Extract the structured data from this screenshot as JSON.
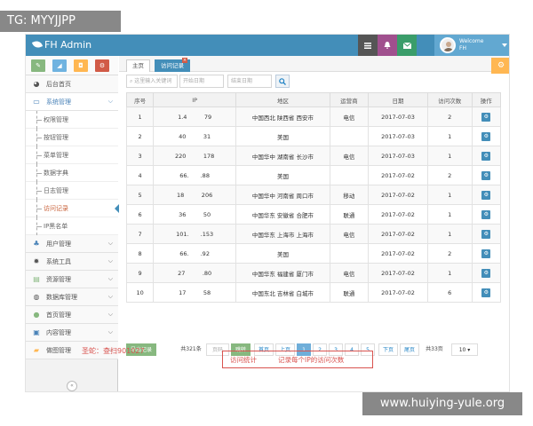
{
  "overlay_label": "TG: MYYJJPP",
  "watermark": "www.huiying-yule.org",
  "footer_note": "圣蛇：查扫901027",
  "app": {
    "title": "FH Admin",
    "welcome": "Welcome",
    "user": "FH",
    "colors": {
      "topbar": "#438eb9",
      "accent": "#438eb9",
      "warning": "#ffb752",
      "danger": "#d15b47",
      "success": "#87b87f"
    }
  },
  "sidebar": {
    "items": [
      {
        "label": "后台首页",
        "icon": "dashboard-icon"
      },
      {
        "label": "系统管理",
        "icon": "desktop-icon"
      },
      {
        "label": "用户管理",
        "icon": "users-icon"
      },
      {
        "label": "系统工具",
        "icon": "cog-icon"
      },
      {
        "label": "资源管理",
        "icon": "list-icon"
      },
      {
        "label": "数据库管理",
        "icon": "database-icon"
      },
      {
        "label": "首页管理",
        "icon": "globe-icon"
      },
      {
        "label": "内容管理",
        "icon": "book-icon"
      },
      {
        "label": "做图管理",
        "icon": "folder-icon"
      }
    ],
    "subitems": [
      "权限管理",
      "按钮管理",
      "菜单管理",
      "数据字典",
      "日志管理",
      "访问记录",
      "IP黑名单"
    ]
  },
  "tabs": [
    {
      "label": "主页"
    },
    {
      "label": "访问记录"
    }
  ],
  "search": {
    "keyword_placeholder": "这里输入关键词",
    "start_placeholder": "开始日期",
    "end_placeholder": "结束日期"
  },
  "table": {
    "headers": [
      "序号",
      "IP",
      "地区",
      "运营商",
      "日期",
      "访问次数",
      "操作"
    ],
    "rows": [
      [
        "1",
        "1.4   79",
        "中国西北 陕西省 西安市",
        "电信",
        "2017-07-03",
        "2"
      ],
      [
        "2",
        "40   31",
        "美国",
        "",
        "2017-07-03",
        "1"
      ],
      [
        "3",
        "220   178",
        "中国华中 湖南省 长沙市",
        "电信",
        "2017-07-03",
        "1"
      ],
      [
        "4",
        "66.  .88",
        "美国",
        "",
        "2017-07-02",
        "2"
      ],
      [
        "5",
        "18   206",
        "中国华中 河南省 周口市",
        "移动",
        "2017-07-02",
        "1"
      ],
      [
        "6",
        "36   50",
        "中国华东 安徽省 合肥市",
        "联通",
        "2017-07-02",
        "1"
      ],
      [
        "7",
        "101.  .153",
        "中国华东 上海市 上海市",
        "电信",
        "2017-07-02",
        "1"
      ],
      [
        "8",
        "66.  .92",
        "美国",
        "",
        "2017-07-02",
        "2"
      ],
      [
        "9",
        "27   .80",
        "中国华东 福建省 厦门市",
        "电信",
        "2017-07-02",
        "1"
      ],
      [
        "10",
        "17   58",
        "中国东北 吉林省 白城市",
        "联通",
        "2017-07-02",
        "6"
      ]
    ]
  },
  "pager": {
    "export_label": "导出记录",
    "total": "共321条",
    "page_input": "页码",
    "go": "跳转",
    "first": "首页",
    "prev": "上页",
    "pages": [
      "1",
      "2",
      "3",
      "4",
      "5"
    ],
    "next": "下页",
    "last": "尾页",
    "total_pages": "共33页",
    "per_page": "10"
  },
  "annotation": {
    "left": "访问统计",
    "right": "记录每个IP的访问次数"
  }
}
